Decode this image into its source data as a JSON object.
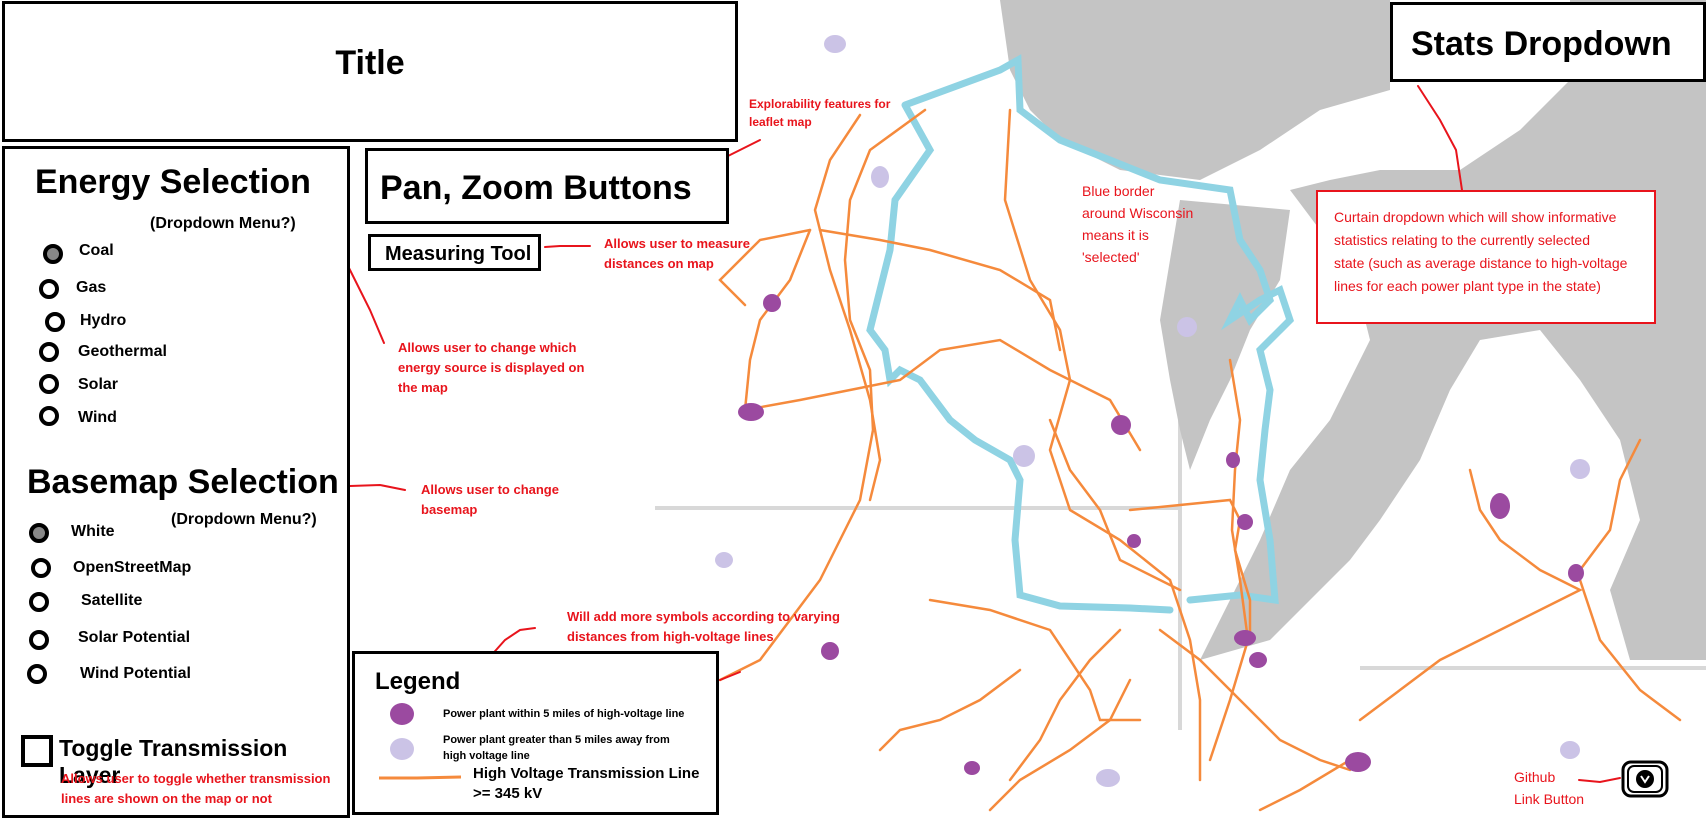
{
  "title": "Title",
  "stats_dropdown": "Stats Dropdown",
  "pan_zoom": "Pan, Zoom Buttons",
  "measuring_tool": "Measuring Tool",
  "energy": {
    "heading": "Energy Selection",
    "dropdown_note": "(Dropdown Menu?)",
    "options": [
      {
        "label": "Coal",
        "selected": true
      },
      {
        "label": "Gas",
        "selected": false
      },
      {
        "label": "Hydro",
        "selected": false
      },
      {
        "label": "Geothermal",
        "selected": false
      },
      {
        "label": "Solar",
        "selected": false
      },
      {
        "label": "Wind",
        "selected": false
      }
    ]
  },
  "basemap": {
    "heading": "Basemap Selection",
    "dropdown_note": "(Dropdown Menu?)",
    "options": [
      {
        "label": "White",
        "selected": true
      },
      {
        "label": "OpenStreetMap",
        "selected": false
      },
      {
        "label": "Satellite",
        "selected": false
      },
      {
        "label": "Solar Potential",
        "selected": false
      },
      {
        "label": "Wind Potential",
        "selected": false
      }
    ]
  },
  "toggle_transmission": "Toggle Transmission Layer",
  "legend": {
    "title": "Legend",
    "within": "Power plant within 5 miles of high-voltage line",
    "greater_line1": "Power plant greater than 5 miles away from",
    "greater_line2": "high voltage line",
    "hv_line1": "High Voltage Transmission Line",
    "hv_line2": ">= 345 kV"
  },
  "annotations": {
    "explorability_1": "Explorability features for",
    "explorability_2": "leaflet map",
    "measure_1": "Allows user to measure",
    "measure_2": "distances on map",
    "energy_1": "Allows user to change which",
    "energy_2": "energy source is displayed on",
    "energy_3": "the map",
    "basemap_1": "Allows user to change",
    "basemap_2": "basemap",
    "toggle_1": "Allows user to toggle whether transmission",
    "toggle_2": "lines are shown on the map or not",
    "symbols_1": "Will add more symbols according to varying",
    "symbols_2": "distances from high-voltage lines",
    "blue_1": "Blue border",
    "blue_2": "around Wisconsin",
    "blue_3": "means it is",
    "blue_4": "'selected'",
    "curtain_1": "Curtain dropdown which will show informative",
    "curtain_2": "statistics relating to the currently selected",
    "curtain_3": "state (such as average distance to high-voltage",
    "curtain_4": "lines for each power plant type in the state)",
    "github_1": "Github",
    "github_2": "Link Button"
  },
  "colors": {
    "annotation_red": "#e8141c",
    "wisconsin_border": "#8fd3e3",
    "transmission_line": "#f58a3c",
    "plant_near": "#9b4aa0",
    "plant_far": "#cbc3e6",
    "land_gray": "#c4c4c4"
  },
  "icons": [
    "github-icon"
  ]
}
